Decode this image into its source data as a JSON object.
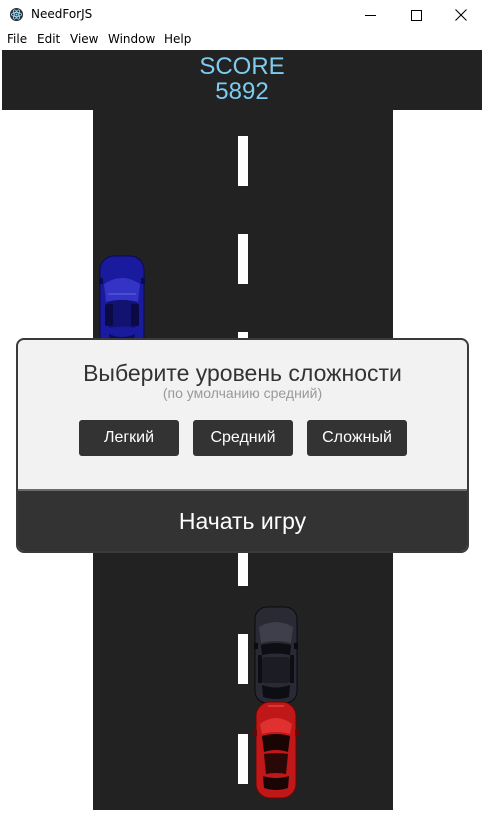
{
  "window": {
    "title": "NeedForJS",
    "icon": "electron-icon",
    "controls": [
      "minimize-icon",
      "maximize-icon",
      "close-icon"
    ]
  },
  "menu": {
    "items": [
      {
        "label": "File"
      },
      {
        "label": "Edit"
      },
      {
        "label": "View"
      },
      {
        "label": "Window"
      },
      {
        "label": "Help"
      }
    ]
  },
  "game": {
    "score_label": "SCORE",
    "score_value": "5892",
    "colors": {
      "score_text": "#7ecbf0",
      "road": "#222222",
      "lane_mark": "#ffffff"
    },
    "cars": [
      {
        "name": "enemy-car-blue",
        "color": "#1a1a9e"
      },
      {
        "name": "enemy-car-dark",
        "color": "#2a2a35"
      },
      {
        "name": "player-car-red",
        "color": "#c01818"
      }
    ]
  },
  "modal": {
    "title": "Выберите уровень сложности",
    "subtitle": "(по умолчанию средний)",
    "buttons": [
      {
        "label": "Легкий"
      },
      {
        "label": "Средний"
      },
      {
        "label": "Сложный"
      }
    ],
    "start_label": "Начать игру"
  }
}
